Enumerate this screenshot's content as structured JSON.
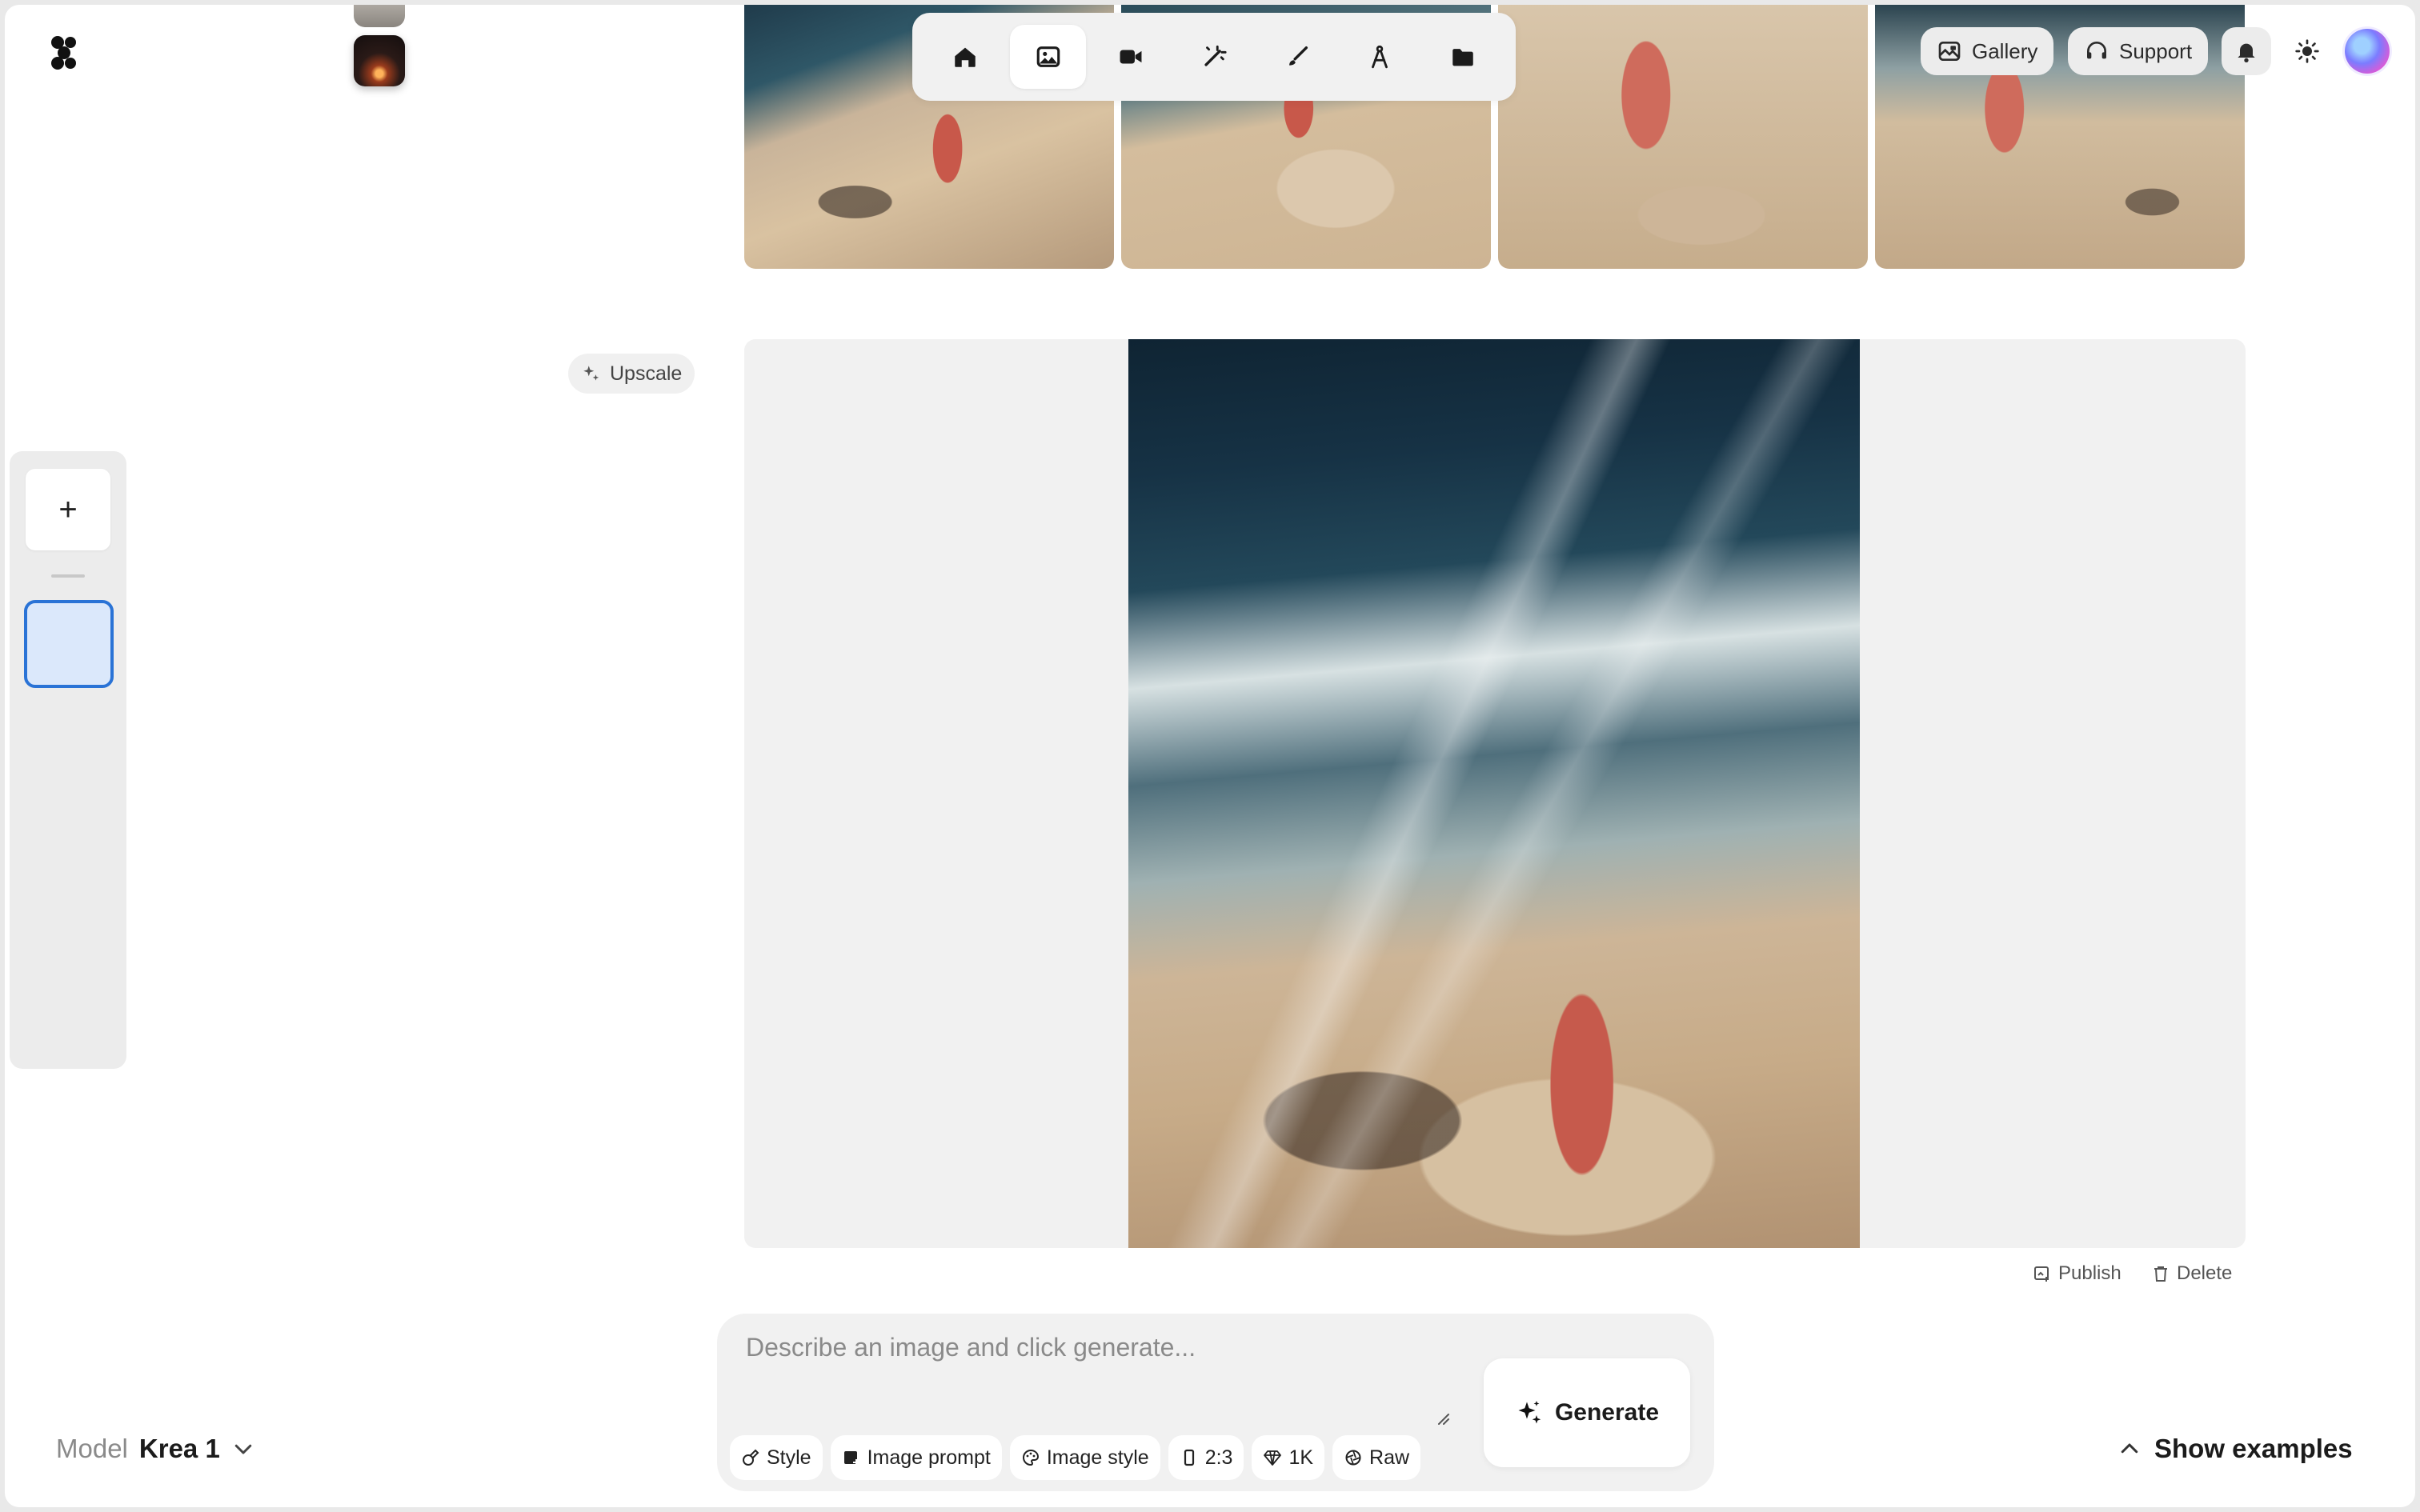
{
  "app": {
    "logo_icon": "krea-logo-icon"
  },
  "toolbar": {
    "items": [
      {
        "icon": "home-icon",
        "active": false
      },
      {
        "icon": "image-icon",
        "active": true
      },
      {
        "icon": "video-icon",
        "active": false
      },
      {
        "icon": "enhance-wand-icon",
        "active": false
      },
      {
        "icon": "realtime-brush-icon",
        "active": false
      },
      {
        "icon": "train-compass-icon",
        "active": false
      },
      {
        "icon": "folder-icon",
        "active": false
      }
    ]
  },
  "header": {
    "gallery_label": "Gallery",
    "support_label": "Support",
    "bell_icon": "bell-icon",
    "theme_icon": "sun-icon"
  },
  "sidebar": {
    "add_label": "+"
  },
  "image_actions": {
    "upscale_label": "Upscale",
    "publish_label": "Publish",
    "delete_label": "Delete"
  },
  "prompt": {
    "placeholder": "Describe an image and click generate...",
    "value": "",
    "chips": [
      {
        "label": "Style",
        "icon": "style-icon"
      },
      {
        "label": "Image prompt",
        "icon": "image-prompt-icon"
      },
      {
        "label": "Image style",
        "icon": "palette-icon"
      },
      {
        "label": "2:3",
        "icon": "aspect-ratio-icon"
      },
      {
        "label": "1K",
        "icon": "diamond-icon"
      },
      {
        "label": "Raw",
        "icon": "raw-icon"
      }
    ],
    "generate_label": "Generate"
  },
  "model": {
    "label": "Model",
    "value": "Krea 1"
  },
  "footer": {
    "show_examples_label": "Show examples"
  },
  "colors": {
    "accent_blue": "#2a73d6",
    "panel_gray": "#f1f1f1"
  }
}
